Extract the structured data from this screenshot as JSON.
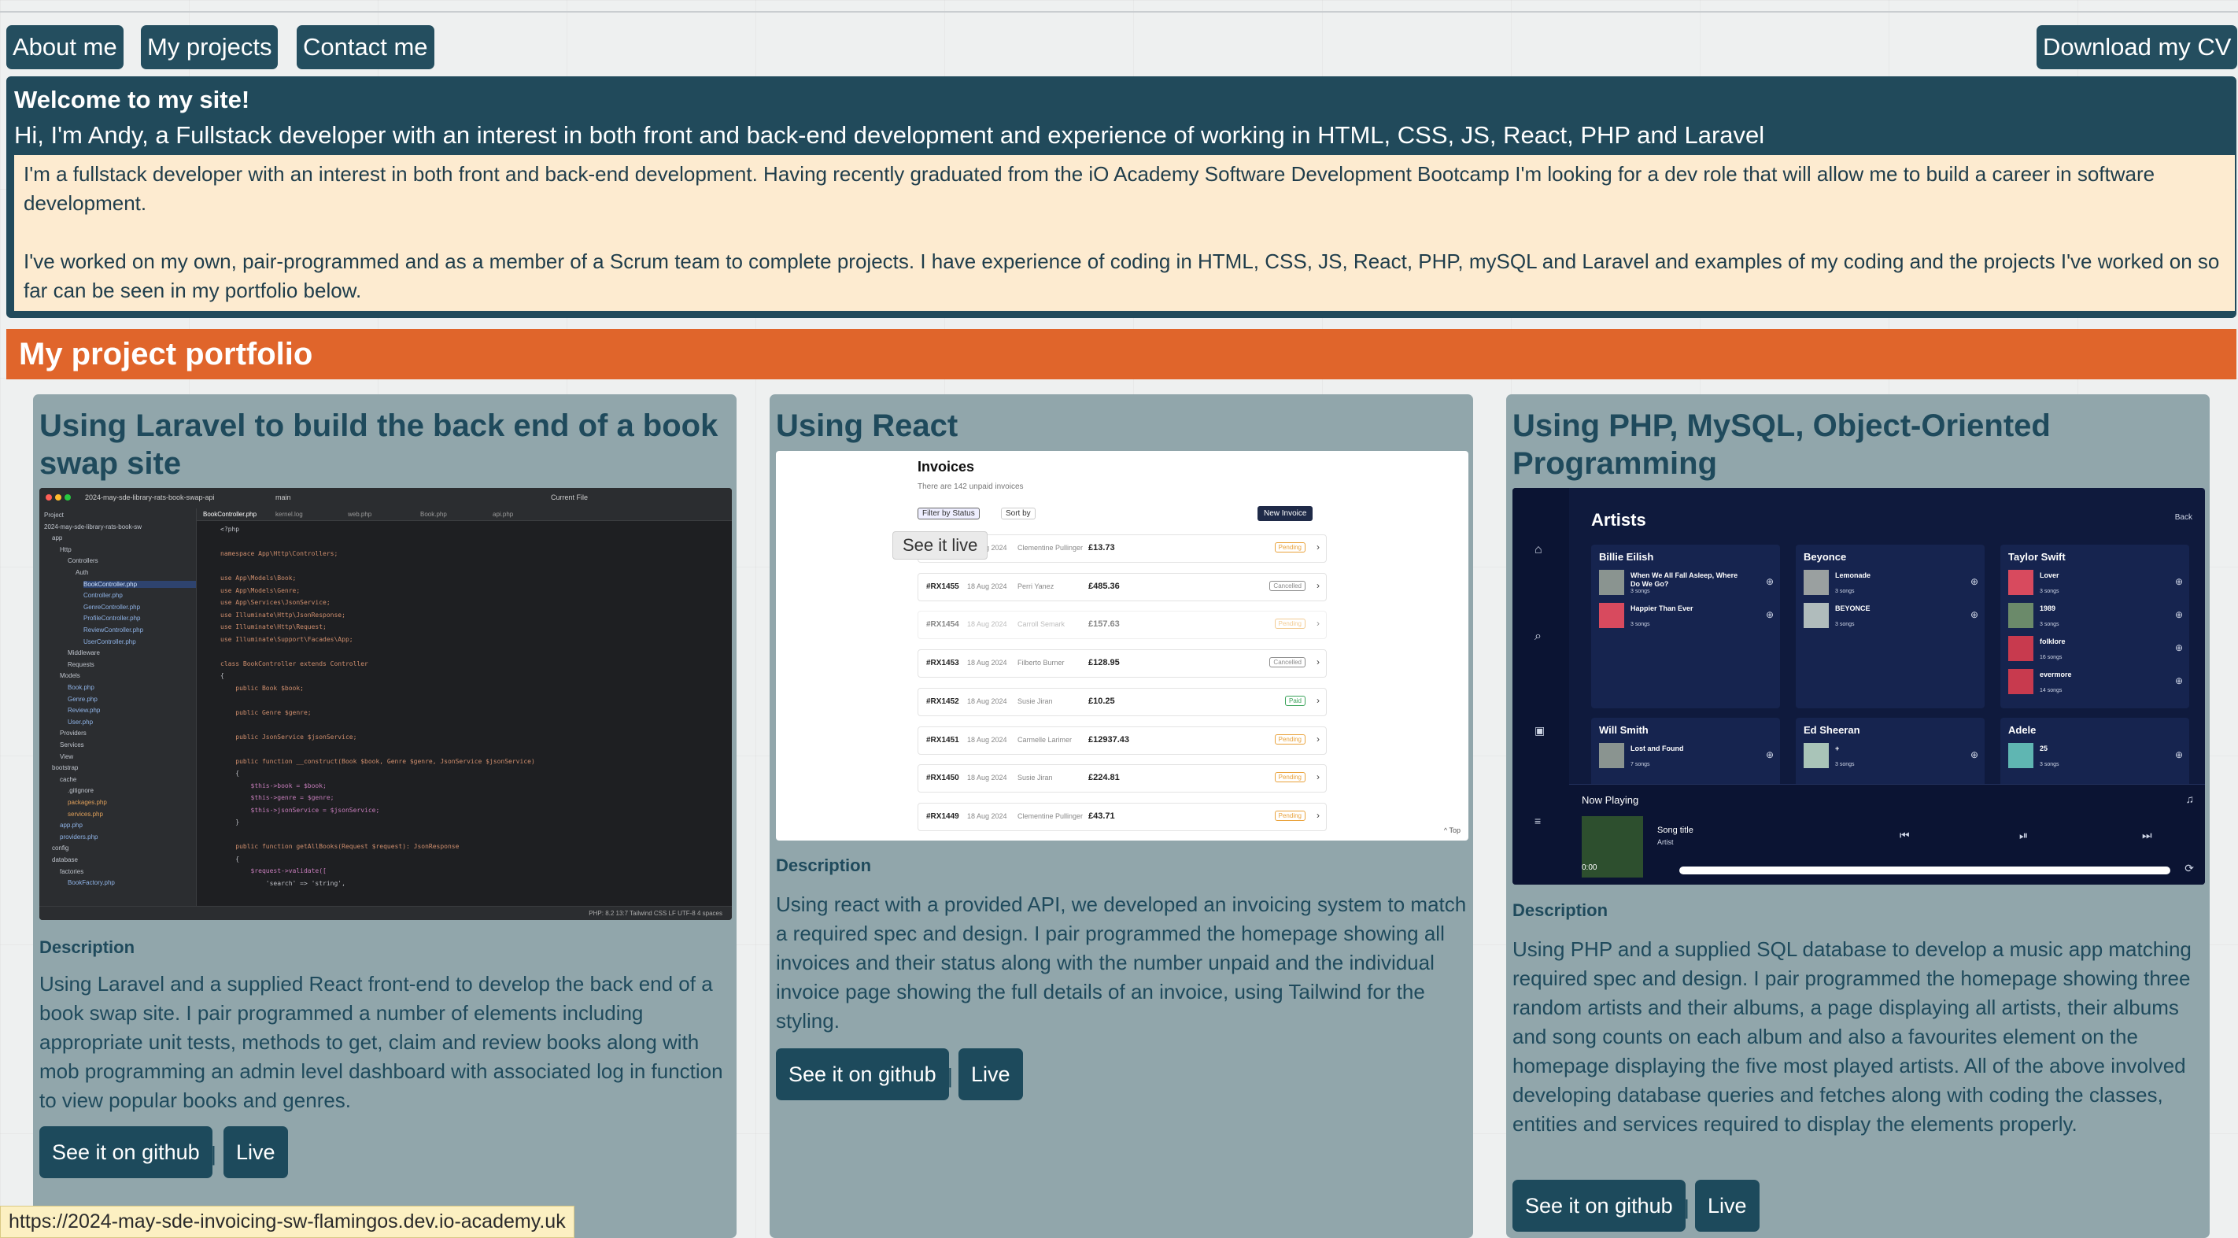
{
  "nav": {
    "about": "About me",
    "projects": "My projects",
    "contact": "Contact me",
    "cv": "Download my CV"
  },
  "welcome": {
    "title": "Welcome to my site!",
    "subtitle": "Hi, I'm Andy, a Fullstack developer with an interest in both front and back-end development and experience of working in HTML, CSS, JS, React, PHP and Laravel",
    "para1": "I'm a fullstack developer with an interest in both front and back-end development. Having recently graduated from the iO Academy Software Development Bootcamp I'm looking for a dev role that will allow me to build a career in software development.",
    "para2": "I've worked on my own, pair-programmed and as a member of a Scrum team to complete projects. I have experience of coding in HTML, CSS, JS, React, PHP, mySQL and Laravel and examples of my coding and the projects I've worked on so far can be seen in my portfolio below."
  },
  "portfolio_heading": "My project portfolio",
  "projects": [
    {
      "title": "Using Laravel to build the back end of a book swap site",
      "desc_label": "Description",
      "desc": "Using Laravel and a supplied React front-end to develop the back end of a book swap site. I pair programmed a number of elements including appropriate unit tests, methods to get, claim and review books along with mob programming an admin level dashboard with associated log in function to view popular books and genres.",
      "github": "See it on github",
      "sep": "|",
      "live": "Live"
    },
    {
      "title": "Using React",
      "desc_label": "Description",
      "desc": "Using react with a provided API, we developed an invoicing system to match a required spec and design. I pair programmed the homepage showing all invoices and their status along with the number unpaid and the individual invoice page showing the full details of an invoice, using Tailwind for the styling.",
      "github": "See it on github",
      "sep": "|",
      "live": "Live",
      "tooltip": "See it live"
    },
    {
      "title": "Using PHP, MySQL, Object-Oriented Programming",
      "desc_label": "Description",
      "desc": "Using PHP and a supplied SQL database to develop a music app matching required spec and design. I pair programmed the homepage showing three random artists and their albums, a page displaying all artists, their albums and song counts on each album and also a favourites element on the homepage displaying the five most played artists. All of the above involved developing database queries and fetches along with coding the classes, entities and services required to display the elements properly.",
      "github": "See it on github",
      "sep": "|",
      "live": "Live"
    }
  ],
  "ide": {
    "project": "2024-may-sde-library-rats-book-swap-api",
    "branch": "main",
    "current_file": "Current File",
    "tabs": [
      "BookController.php",
      "kernel.log",
      "web.php",
      "Book.php",
      "api.php"
    ],
    "status": "PHP: 8.2   13:7   Tailwind CSS   LF   UTF-8   4 spaces",
    "tree": [
      "Project",
      "2024-may-sde-library-rats-book-sw",
      "app",
      "Http",
      "Controllers",
      "Auth",
      "BookController.php",
      "Controller.php",
      "GenreController.php",
      "ProfileController.php",
      "ReviewController.php",
      "UserController.php",
      "Middleware",
      "Requests",
      "Models",
      "Book.php",
      "Genre.php",
      "Review.php",
      "User.php",
      "Providers",
      "Services",
      "View",
      "bootstrap",
      "cache",
      ".gitignore",
      "packages.php",
      "services.php",
      "app.php",
      "providers.php",
      "config",
      "database",
      "factories",
      "BookFactory.php"
    ],
    "code": [
      "<?php",
      "",
      "namespace App\\Http\\Controllers;",
      "",
      "use App\\Models\\Book;",
      "use App\\Models\\Genre;",
      "use App\\Services\\JsonService;",
      "use Illuminate\\Http\\JsonResponse;",
      "use Illuminate\\Http\\Request;",
      "use Illuminate\\Support\\Facades\\App;",
      "",
      "class BookController extends Controller",
      "{",
      "    public Book $book;",
      "",
      "    public Genre $genre;",
      "",
      "    public JsonService $jsonService;",
      "",
      "    public function __construct(Book $book, Genre $genre, JsonService $jsonService)",
      "    {",
      "        $this->book = $book;",
      "        $this->genre = $genre;",
      "        $this->jsonService = $jsonService;",
      "    }",
      "",
      "    public function getAllBooks(Request $request): JsonResponse",
      "    {",
      "        $request->validate([",
      "            'search' => 'string',"
    ]
  },
  "invoices": {
    "title": "Invoices",
    "sub": "There are 142 unpaid invoices",
    "filter": "Filter by Status",
    "sort": "Sort by",
    "new": "New Invoice",
    "top": "^ Top",
    "rows": [
      {
        "id": "#RX1456",
        "date": "18 Aug 2024",
        "name": "Clementine Pullinger",
        "amount": "£13.73",
        "status": "Pending"
      },
      {
        "id": "#RX1455",
        "date": "18 Aug 2024",
        "name": "Perri Yanez",
        "amount": "£485.36",
        "status": "Cancelled"
      },
      {
        "id": "#RX1454",
        "date": "18 Aug 2024",
        "name": "Carroll Semark",
        "amount": "£157.63",
        "status": "Pending"
      },
      {
        "id": "#RX1453",
        "date": "18 Aug 2024",
        "name": "Filberto Burner",
        "amount": "£128.95",
        "status": "Cancelled"
      },
      {
        "id": "#RX1452",
        "date": "18 Aug 2024",
        "name": "Susie Jiran",
        "amount": "£10.25",
        "status": "Paid"
      },
      {
        "id": "#RX1451",
        "date": "18 Aug 2024",
        "name": "Carmelle Larimer",
        "amount": "£12937.43",
        "status": "Pending"
      },
      {
        "id": "#RX1450",
        "date": "18 Aug 2024",
        "name": "Susie Jiran",
        "amount": "£224.81",
        "status": "Pending"
      },
      {
        "id": "#RX1449",
        "date": "18 Aug 2024",
        "name": "Clementine Pullinger",
        "amount": "£43.71",
        "status": "Pending"
      }
    ]
  },
  "music": {
    "title": "Artists",
    "back": "Back",
    "artists": [
      {
        "name": "Billie Eilish",
        "albums": [
          {
            "t": "When We All Fall Asleep, Where Do We Go?",
            "s": "3 songs",
            "c": "#8a9490"
          },
          {
            "t": "Happier Than Ever",
            "s": "3 songs",
            "c": "#d84a5e"
          }
        ]
      },
      {
        "name": "Beyonce",
        "albums": [
          {
            "t": "Lemonade",
            "s": "3 songs",
            "c": "#9aa0a0"
          },
          {
            "t": "BEYONCE",
            "s": "3 songs",
            "c": "#b0bcbc"
          }
        ]
      },
      {
        "name": "Taylor Swift",
        "albums": [
          {
            "t": "Lover",
            "s": "3 songs",
            "c": "#d84a5e"
          },
          {
            "t": "1989",
            "s": "3 songs",
            "c": "#6b8a6a"
          },
          {
            "t": "folklore",
            "s": "16 songs",
            "c": "#c83a4e"
          },
          {
            "t": "evermore",
            "s": "14 songs",
            "c": "#c83a4e"
          }
        ]
      },
      {
        "name": "Will Smith",
        "albums": [
          {
            "t": "Lost and Found",
            "s": "7 songs",
            "c": "#8a9490"
          }
        ]
      },
      {
        "name": "Ed Sheeran",
        "albums": [
          {
            "t": "+",
            "s": "3 songs",
            "c": "#a9c4b8"
          }
        ]
      },
      {
        "name": "Adele",
        "albums": [
          {
            "t": "25",
            "s": "3 songs",
            "c": "#5fb6b2"
          }
        ]
      }
    ],
    "now_playing": "Now Playing",
    "song": "Song title",
    "artist": "Artist",
    "time": "0:00"
  },
  "status_url": "https://2024-may-sde-invoicing-sw-flamingos.dev.io-academy.uk"
}
